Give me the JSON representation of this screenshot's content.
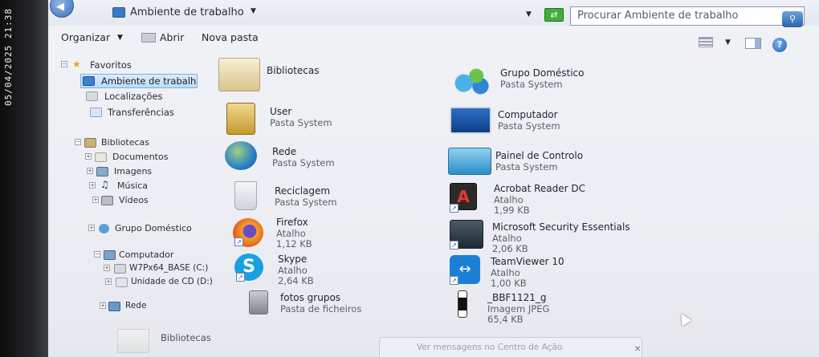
{
  "timestamp": "05/04/2025 21:38",
  "address": {
    "breadcrumb": "Ambiente de trabalho",
    "search_placeholder": "Procurar Ambiente de trabalho"
  },
  "toolbar": {
    "organize": "Organizar",
    "open": "Abrir",
    "new_folder": "Nova pasta"
  },
  "nav": {
    "favorites": "Favoritos",
    "desktop": "Ambiente de trabalh",
    "places": "Localizações",
    "downloads": "Transferências",
    "libraries": "Bibliotecas",
    "documents": "Documentos",
    "images": "Imagens",
    "music": "Música",
    "videos": "Vídeos",
    "homegroup": "Grupo Doméstico",
    "computer": "Computador",
    "drive_c": "W7Px64_BASE (C:)",
    "drive_d": "Unidade de CD (D:)",
    "network": "Rede"
  },
  "items": {
    "bibliotecas": {
      "name": "Bibliotecas"
    },
    "grupo": {
      "name": "Grupo Doméstico",
      "sub": "Pasta System"
    },
    "user": {
      "name": "User",
      "sub": "Pasta System"
    },
    "computador": {
      "name": "Computador",
      "sub": "Pasta System"
    },
    "rede": {
      "name": "Rede",
      "sub": "Pasta System"
    },
    "painel": {
      "name": "Painel de Controlo",
      "sub": "Pasta System"
    },
    "reciclagem": {
      "name": "Reciclagem",
      "sub": "Pasta System"
    },
    "acrobat": {
      "name": "Acrobat Reader DC",
      "sub": "Atalho",
      "size": "1,99 KB"
    },
    "firefox": {
      "name": "Firefox",
      "sub": "Atalho",
      "size": "1,12 KB"
    },
    "mse": {
      "name": "Microsoft Security Essentials",
      "sub": "Atalho",
      "size": "2,06 KB"
    },
    "skype": {
      "name": "Skype",
      "sub": "Atalho",
      "size": "2,64 KB"
    },
    "teamviewer": {
      "name": "TeamViewer 10",
      "sub": "Atalho",
      "size": "1,00 KB"
    },
    "fotos": {
      "name": "fotos grupos",
      "sub": "Pasta de ficheiros"
    },
    "jpeg": {
      "name": "_BBF1121_g",
      "sub": "Imagem JPEG",
      "size": "65,4 KB"
    }
  },
  "bottom": {
    "library": "Bibliotecas",
    "status": "Ver mensagens no Centro de Ação"
  },
  "colors": {
    "selection": "#bcdcf6",
    "accent": "#3b79c7"
  }
}
